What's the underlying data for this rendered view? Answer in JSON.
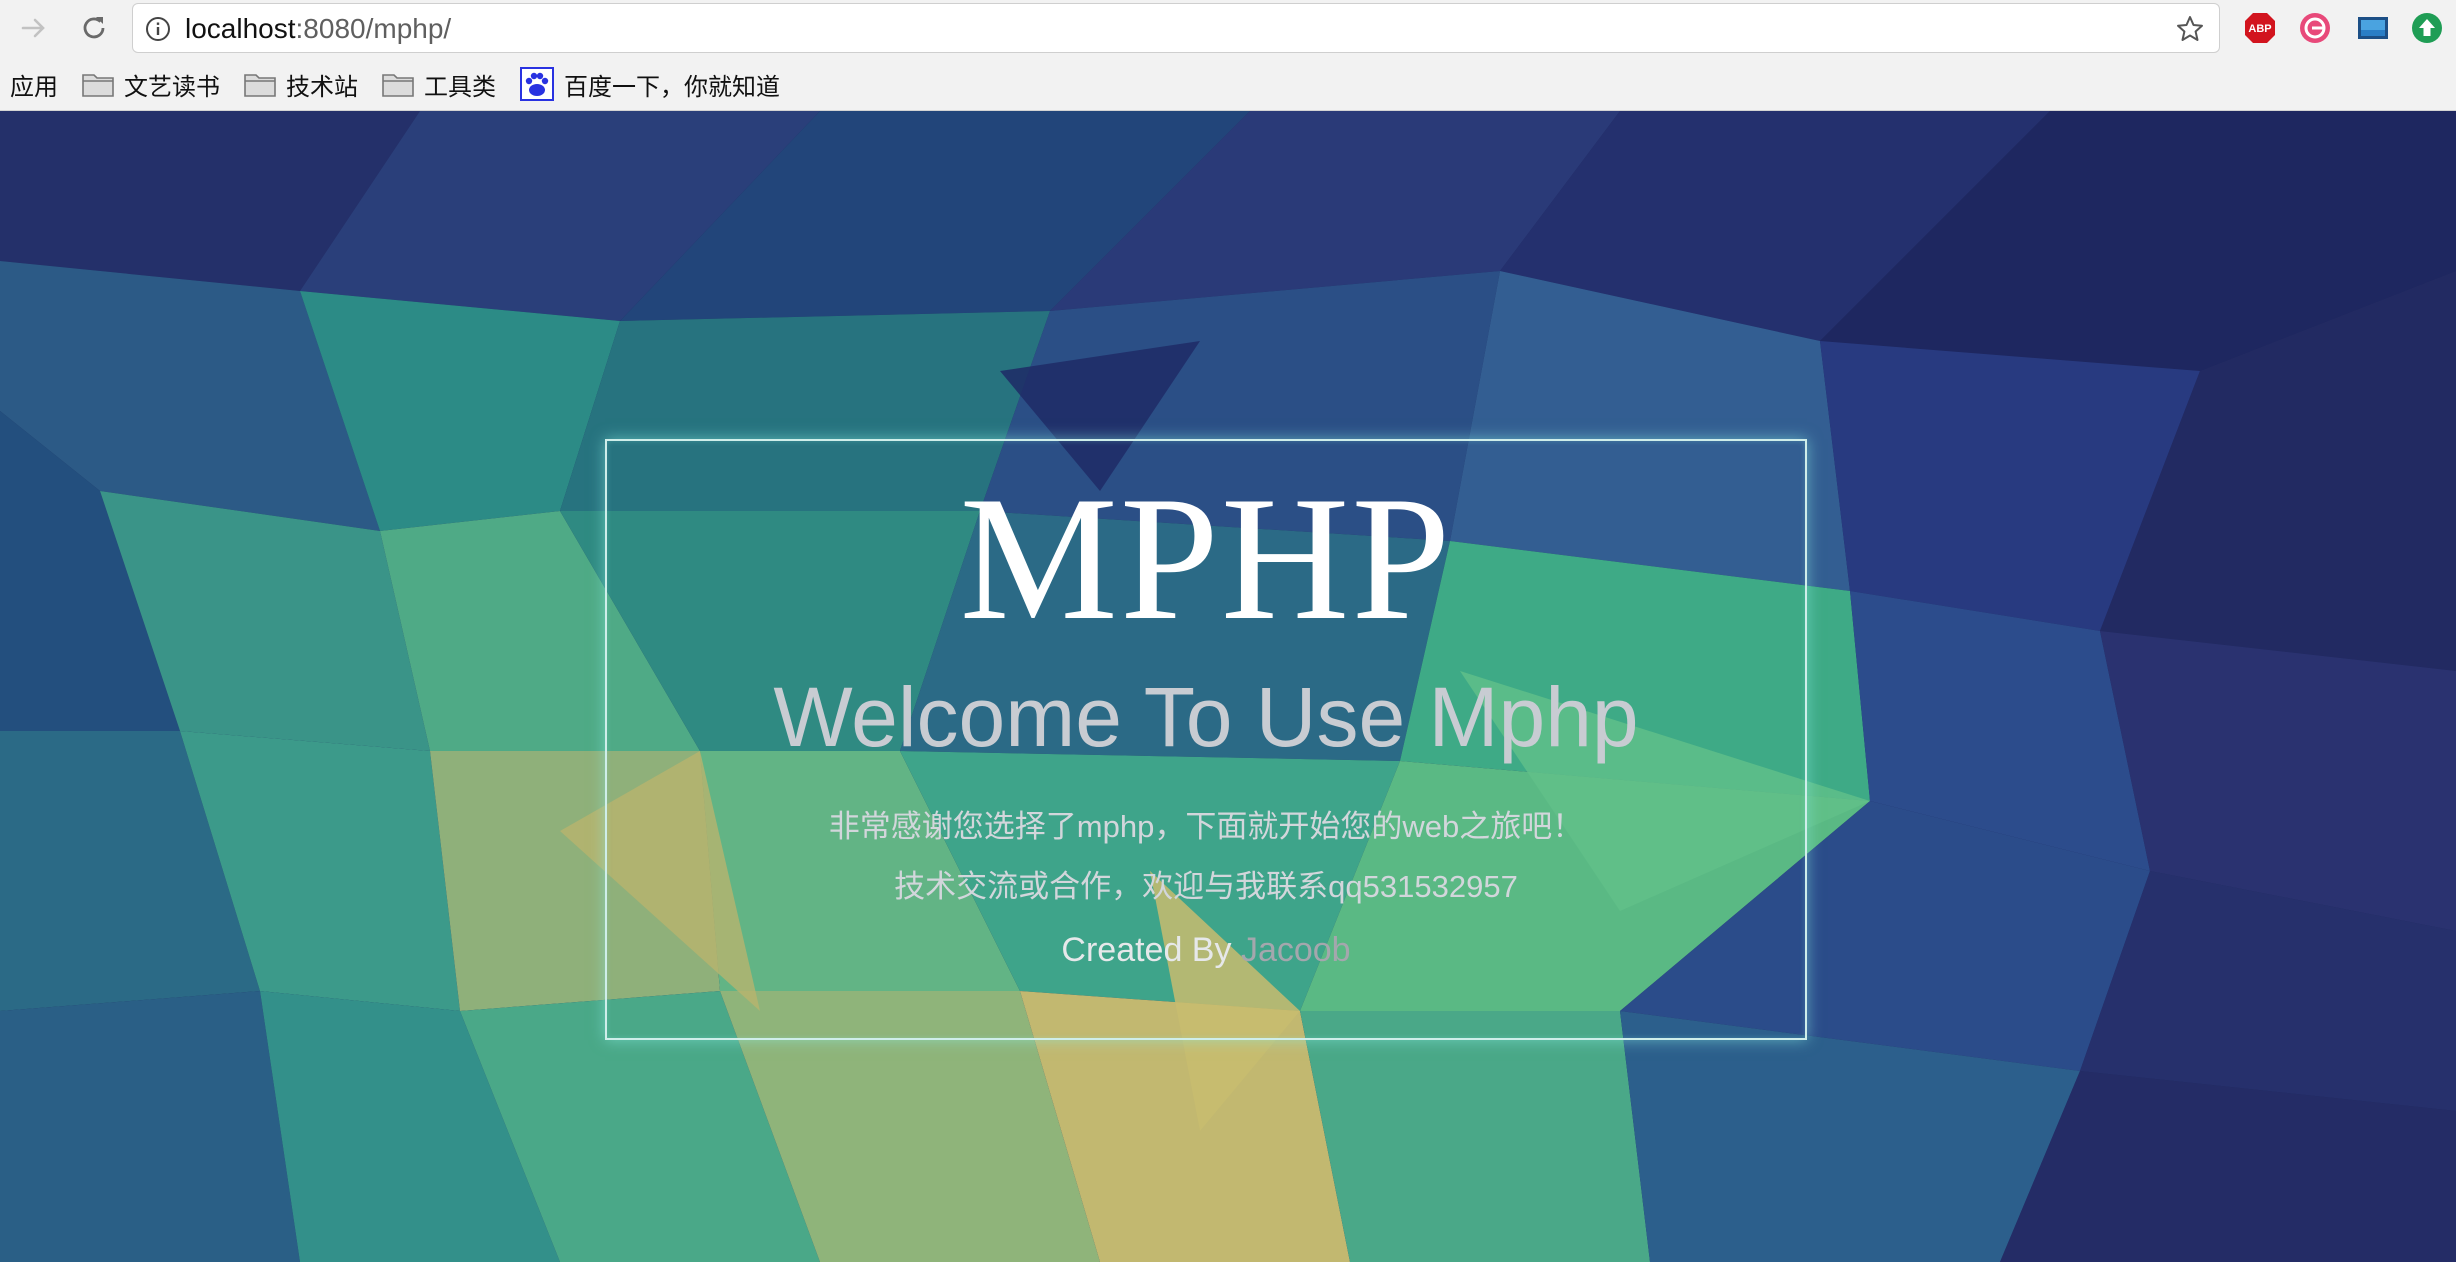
{
  "browser": {
    "url_host": "localhost",
    "url_rest": ":8080/mphp/",
    "icons": {
      "back": "arrow-right-icon",
      "reload": "reload-icon",
      "info": "info-icon",
      "bookmark_star": "star-icon"
    },
    "extensions": [
      {
        "name": "adblock-plus-icon",
        "label": "ABP",
        "color": "#d2141e"
      },
      {
        "name": "grammar-extension-icon",
        "color": "#e8497a"
      },
      {
        "name": "screen-capture-icon",
        "color": "#2a7ec6"
      },
      {
        "name": "upload-extension-icon",
        "color": "#1f9d55"
      }
    ]
  },
  "bookmarks": {
    "apps_label": "应用",
    "items": [
      {
        "label": "文艺读书",
        "icon": "folder-icon"
      },
      {
        "label": "技术站",
        "icon": "folder-icon"
      },
      {
        "label": "工具类",
        "icon": "folder-icon"
      },
      {
        "label": "百度一下，你就知道",
        "icon": "baidu-paw-icon"
      }
    ]
  },
  "page": {
    "brand": "MPHP",
    "heading": "Welcome To Use Mphp",
    "line1": "非常感谢您选择了mphp，下面就开始您的web之旅吧！",
    "line2": "技术交流或合作，欢迎与我联系qq531532957",
    "credit_prefix": "Created By ",
    "credit_author": "Jacoob",
    "colors": {
      "panel_border": "#cfeeea",
      "brand_text": "#ffffff",
      "heading_text": "#c8ccd2",
      "author_text": "#a4a7ad",
      "background_base": "#1f2a5c"
    }
  }
}
